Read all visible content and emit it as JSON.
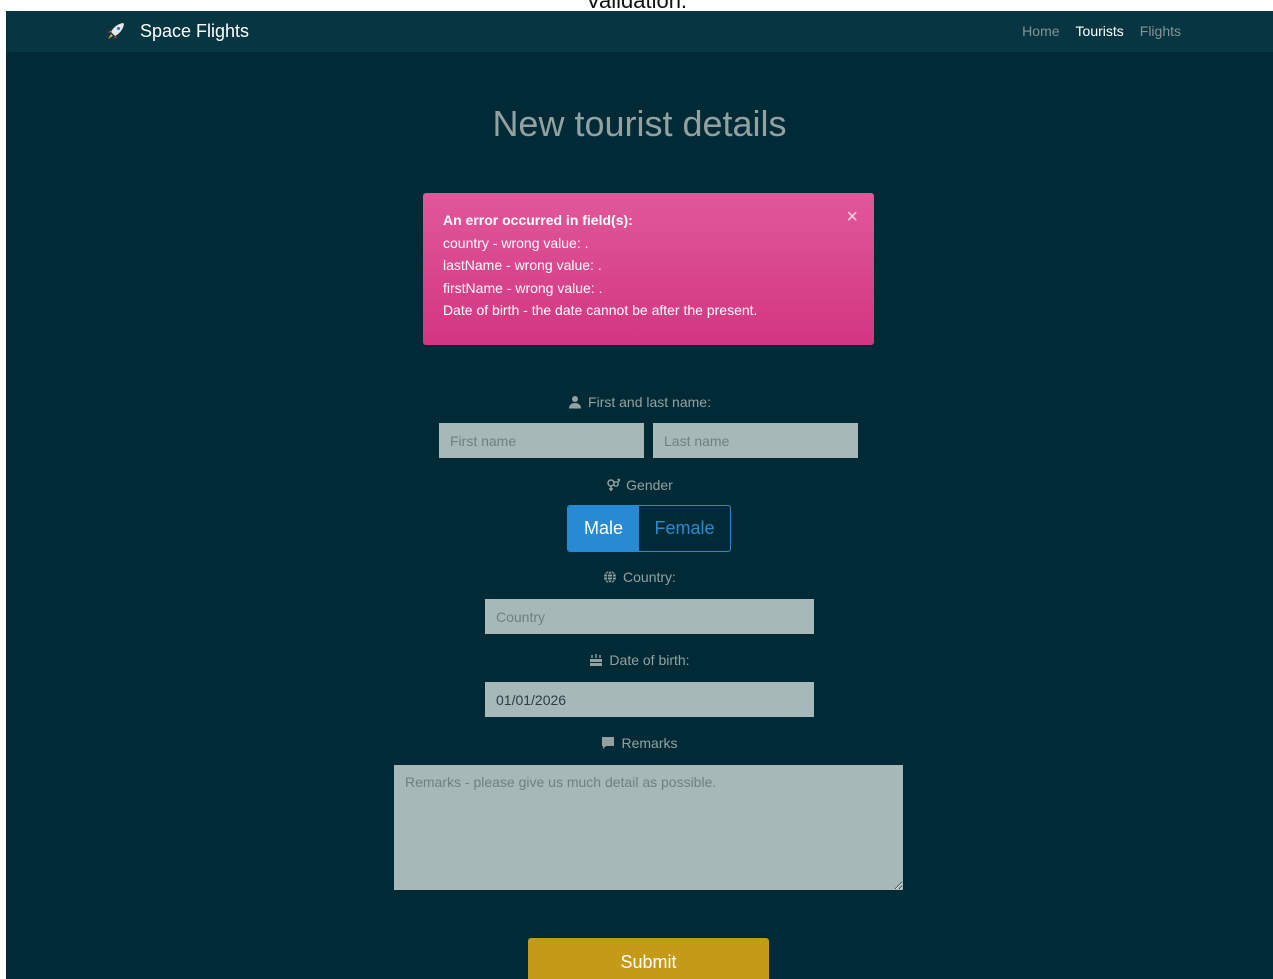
{
  "caption": "Validation.",
  "navbar": {
    "brand": "Space Flights",
    "brand_icon": "rocket-icon",
    "links": [
      {
        "label": "Home",
        "active": false
      },
      {
        "label": "Tourists",
        "active": true
      },
      {
        "label": "Flights",
        "active": false
      }
    ]
  },
  "page_title": "New tourist details",
  "alert": {
    "heading": "An error occurred in field(s):",
    "lines": [
      "country - wrong value: .",
      "lastName - wrong value: .",
      "firstName - wrong value: .",
      "Date of birth - the date cannot be after the present."
    ],
    "close_glyph": "×"
  },
  "form": {
    "name_label": "First and last name:",
    "first_name_placeholder": "First name",
    "last_name_placeholder": "Last name",
    "gender_label": "Gender",
    "gender_options": [
      "Male",
      "Female"
    ],
    "gender_selected": "Male",
    "country_label": "Country:",
    "country_placeholder": "Country",
    "dob_label": "Date of birth:",
    "dob_value": "01/01/2026",
    "remarks_label": "Remarks",
    "remarks_placeholder": "Remarks - please give us much detail as possible.",
    "submit_label": "Submit"
  },
  "colors": {
    "background": "#002b36",
    "navbar": "#073642",
    "alert": "#d33682",
    "accent": "#268bd2",
    "submit": "#c59a18",
    "input": "#a7b8b8"
  }
}
